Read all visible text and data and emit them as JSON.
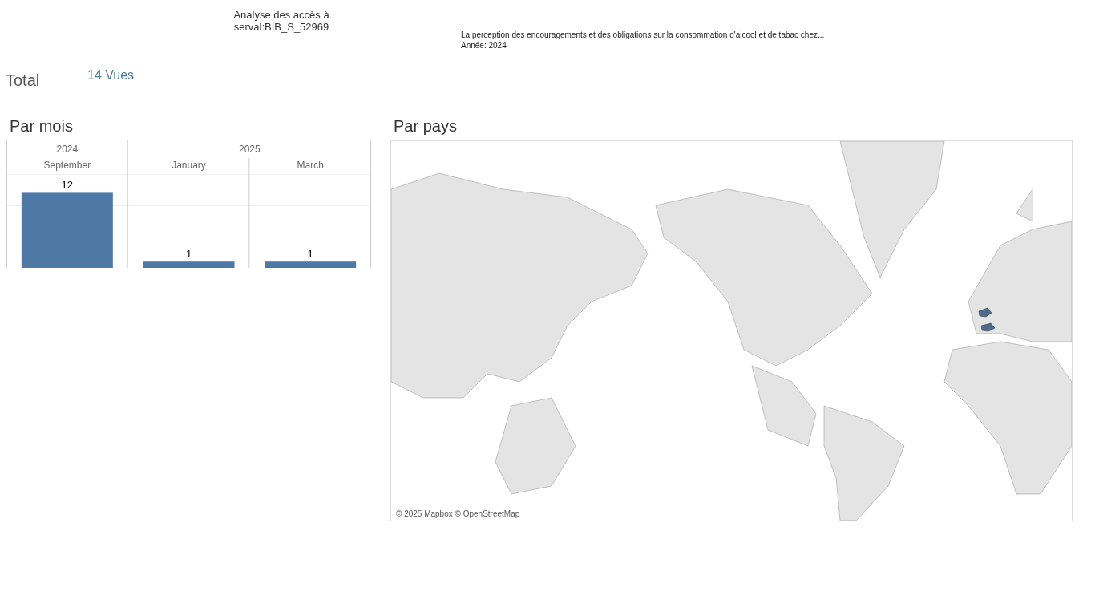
{
  "header": {
    "title": "Analyse des accès à serval:BIB_S_52969",
    "subtitle": "La perception des encouragements et des obligations sur la consommation d'alcool et de tabac chez...",
    "year": "Année: 2024"
  },
  "total": {
    "label": "Total",
    "value": "14 Vues"
  },
  "by_month": {
    "title": "Par mois",
    "year_row": [
      {
        "label": "2024"
      },
      {
        "label": "2025"
      }
    ],
    "chart_data": {
      "type": "bar",
      "categories": [
        "September",
        "January",
        "March"
      ],
      "values": [
        12,
        1,
        1
      ],
      "data_labels": true
    }
  },
  "by_country": {
    "title": "Par pays",
    "attribution": "© 2025 Mapbox © OpenStreetMap"
  }
}
